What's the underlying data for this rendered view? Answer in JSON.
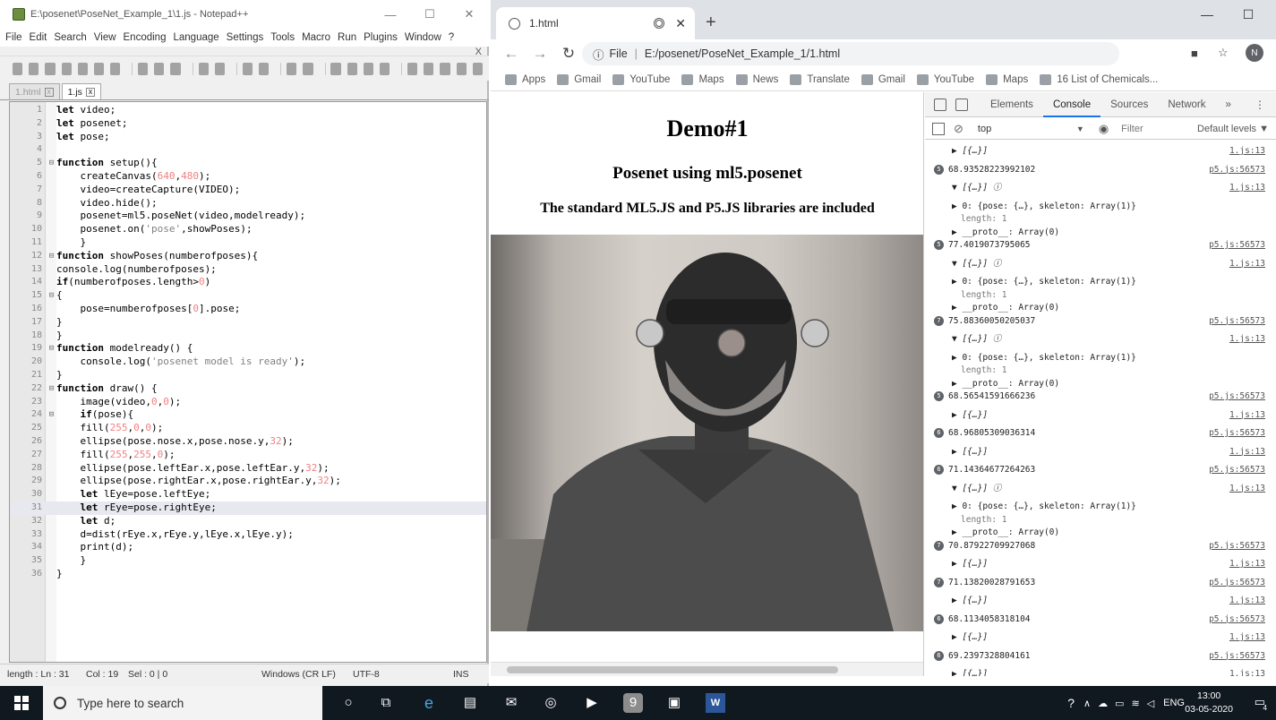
{
  "npp": {
    "title": "E:\\posenet\\PoseNet_Example_1\\1.js - Notepad++",
    "close_x": "X",
    "menu": [
      "File",
      "Edit",
      "Search",
      "View",
      "Encoding",
      "Language",
      "Settings",
      "Tools",
      "Macro",
      "Run",
      "Plugins",
      "Window",
      "?"
    ],
    "tabs": [
      {
        "label": "1.html"
      },
      {
        "label": "1.js"
      }
    ],
    "status": {
      "pos": "length : Ln : 31",
      "col": "Col : 19",
      "sel": "Sel : 0 | 0",
      "eol": "Windows (CR LF)",
      "enc": "UTF-8",
      "mode": "INS"
    }
  },
  "code": [
    "let video;",
    "let posenet;",
    "let pose;",
    "",
    "function setup(){",
    "    createCanvas(640,480);",
    "    video=createCapture(VIDEO);",
    "    video.hide();",
    "    posenet=ml5.poseNet(video,modelready);",
    "    posenet.on('pose',showPoses);",
    "    }",
    "function showPoses(numberofposes){",
    "console.log(numberofposes);",
    "if(numberofposes.length>0)",
    "{",
    "    pose=numberofposes[0].pose;",
    "}",
    "}",
    "function modelready() {",
    "    console.log('posenet model is ready');",
    "}",
    "function draw() {",
    "    image(video,0,0);",
    "    if(pose){",
    "    fill(255,0,0);",
    "    ellipse(pose.nose.x,pose.nose.y,32);",
    "    fill(255,255,0);",
    "    ellipse(pose.leftEar.x,pose.leftEar.y,32);",
    "    ellipse(pose.rightEar.x,pose.rightEar.y,32);",
    "    let lEye=pose.leftEye;",
    "    let rEye=pose.rightEye;",
    "    let d;",
    "    d=dist(rEye.x,rEye.y,lEye.x,lEye.y);",
    "    print(d);",
    "    }",
    "}"
  ],
  "chrome": {
    "tab_title": "1.html",
    "new_tab": "+",
    "address_prefix": "File",
    "address": "E:/posenet/PoseNet_Example_1/1.html",
    "avatar": "N",
    "bookmarks": [
      "Apps",
      "Gmail",
      "YouTube",
      "Maps",
      "News",
      "Translate",
      "Gmail",
      "YouTube",
      "Maps",
      "16 List of Chemicals..."
    ]
  },
  "page": {
    "h1": "Demo#1",
    "h2": "Posenet using ml5.posenet",
    "h3": "The standard ML5.JS and P5.JS libraries are included"
  },
  "devtools": {
    "tabs": [
      "Elements",
      "Console",
      "Sources",
      "Network",
      "»"
    ],
    "context": "top",
    "filter_placeholder": "Filter",
    "levels": "Default levels ▼"
  },
  "console": [
    {
      "kind": "arr",
      "text": "▶ [{…}]",
      "src": "1.js:13"
    },
    {
      "kind": "num",
      "badge": "5",
      "text": "68.93528223992102",
      "src": "p5.js:56573"
    },
    {
      "kind": "arr",
      "text": "▼ [{…}] ⓘ",
      "src": "1.js:13"
    },
    {
      "kind": "sub",
      "text": "▶ 0: {pose: {…}, skeleton: Array(1)}"
    },
    {
      "kind": "sub2",
      "text": "length: 1"
    },
    {
      "kind": "sub",
      "text": "▶ __proto__: Array(0)"
    },
    {
      "kind": "num",
      "badge": "5",
      "text": "77.4019073795065",
      "src": "p5.js:56573"
    },
    {
      "kind": "arr",
      "text": "▼ [{…}] ⓘ",
      "src": "1.js:13"
    },
    {
      "kind": "sub",
      "text": "▶ 0: {pose: {…}, skeleton: Array(1)}"
    },
    {
      "kind": "sub2",
      "text": "length: 1"
    },
    {
      "kind": "sub",
      "text": "▶ __proto__: Array(0)"
    },
    {
      "kind": "num",
      "badge": "7",
      "text": "75.88360050205037",
      "src": "p5.js:56573"
    },
    {
      "kind": "arr",
      "text": "▼ [{…}] ⓘ",
      "src": "1.js:13"
    },
    {
      "kind": "sub",
      "text": "▶ 0: {pose: {…}, skeleton: Array(1)}"
    },
    {
      "kind": "sub2",
      "text": "length: 1"
    },
    {
      "kind": "sub",
      "text": "▶ __proto__: Array(0)"
    },
    {
      "kind": "num",
      "badge": "5",
      "text": "68.56541591666236",
      "src": "p5.js:56573"
    },
    {
      "kind": "arr",
      "text": "▶ [{…}]",
      "src": "1.js:13"
    },
    {
      "kind": "num",
      "badge": "6",
      "text": "68.96805309036314",
      "src": "p5.js:56573"
    },
    {
      "kind": "arr",
      "text": "▶ [{…}]",
      "src": "1.js:13"
    },
    {
      "kind": "num",
      "badge": "6",
      "text": "71.14364677264263",
      "src": "p5.js:56573"
    },
    {
      "kind": "arr",
      "text": "▼ [{…}] ⓘ",
      "src": "1.js:13"
    },
    {
      "kind": "sub",
      "text": "▶ 0: {pose: {…}, skeleton: Array(1)}"
    },
    {
      "kind": "sub2",
      "text": "length: 1"
    },
    {
      "kind": "sub",
      "text": "▶ __proto__: Array(0)"
    },
    {
      "kind": "num",
      "badge": "7",
      "text": "70.87922709927068",
      "src": "p5.js:56573"
    },
    {
      "kind": "arr",
      "text": "▶ [{…}]",
      "src": "1.js:13"
    },
    {
      "kind": "num",
      "badge": "7",
      "text": "71.13820028791653",
      "src": "p5.js:56573"
    },
    {
      "kind": "arr",
      "text": "▶ [{…}]",
      "src": "1.js:13"
    },
    {
      "kind": "num",
      "badge": "6",
      "text": "68.1134058318104",
      "src": "p5.js:56573"
    },
    {
      "kind": "arr",
      "text": "▶ [{…}]",
      "src": "1.js:13"
    },
    {
      "kind": "num",
      "badge": "6",
      "text": "69.2397328804161",
      "src": "p5.js:56573"
    },
    {
      "kind": "arr",
      "text": "▶ [{…}]",
      "src": "1.js:13"
    }
  ],
  "taskbar": {
    "search_placeholder": "Type here to search",
    "lang": "ENG",
    "time": "13:00",
    "date": "03-05-2020",
    "notif": "4"
  },
  "colors": {
    "taskbar": "#101820",
    "chrome_tab_strip": "#dee1e6",
    "active_devtab": "#1a73e8"
  }
}
